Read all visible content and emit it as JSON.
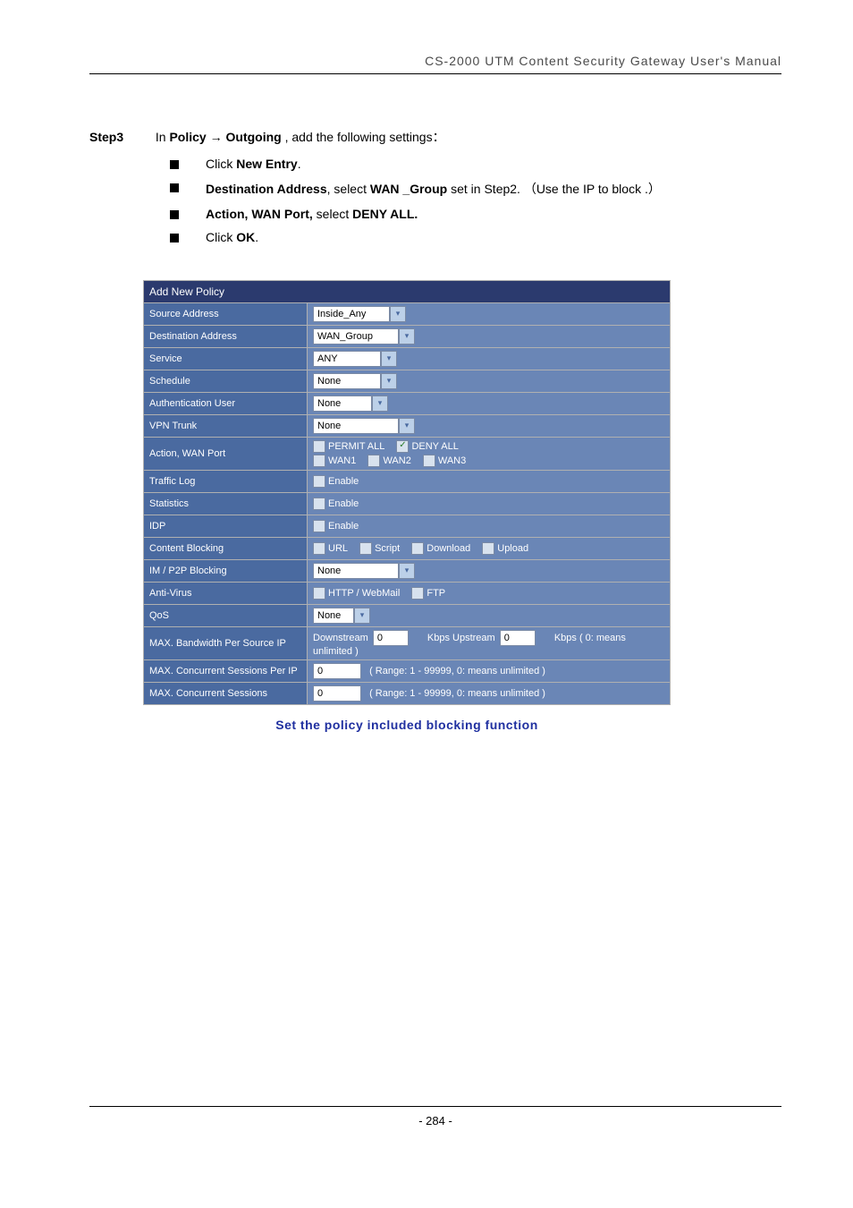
{
  "header": "CS-2000 UTM Content Security Gateway User's Manual",
  "step": {
    "label": "Step3",
    "pre": "In ",
    "b1": "Policy",
    "arrow": " → ",
    "b2": "Outgoing",
    "post": " , add the following settings："
  },
  "bullets": [
    {
      "parts": [
        {
          "t": "Click "
        },
        {
          "t": "New Entry",
          "b": true
        },
        {
          "t": "."
        }
      ]
    },
    {
      "parts": [
        {
          "t": "Destination Address",
          "b": true
        },
        {
          "t": ", select "
        },
        {
          "t": "WAN _Group",
          "b": true
        },
        {
          "t": " set in Step2. （Use the IP to block .）"
        }
      ]
    },
    {
      "parts": [
        {
          "t": "Action, WAN Port,",
          "b": true
        },
        {
          "t": " select "
        },
        {
          "t": "DENY ALL.",
          "b": true
        }
      ]
    },
    {
      "parts": [
        {
          "t": "Click "
        },
        {
          "t": "OK",
          "b": true
        },
        {
          "t": "."
        }
      ]
    }
  ],
  "policy": {
    "title": "Add New Policy",
    "rows": {
      "source_address": {
        "label": "Source Address",
        "value": "Inside_Any",
        "sel_w": 76
      },
      "destination_address": {
        "label": "Destination Address",
        "value": "WAN_Group",
        "sel_w": 86
      },
      "service": {
        "label": "Service",
        "value": "ANY",
        "sel_w": 66
      },
      "schedule": {
        "label": "Schedule",
        "value": "None",
        "sel_w": 66
      },
      "auth_user": {
        "label": "Authentication User",
        "value": "None",
        "sel_w": 56
      },
      "vpn_trunk": {
        "label": "VPN Trunk",
        "value": "None",
        "sel_w": 86
      },
      "action": {
        "label": "Action, WAN Port",
        "permit_all": "PERMIT ALL",
        "deny_all": "DENY ALL",
        "wan1": "WAN1",
        "wan2": "WAN2",
        "wan3": "WAN3",
        "deny_checked": "✓"
      },
      "traffic_log": {
        "label": "Traffic Log",
        "opt": "Enable"
      },
      "statistics": {
        "label": "Statistics",
        "opt": "Enable"
      },
      "idp": {
        "label": "IDP",
        "opt": "Enable"
      },
      "content_blocking": {
        "label": "Content Blocking",
        "url": "URL",
        "script": "Script",
        "download": "Download",
        "upload": "Upload"
      },
      "im_p2p": {
        "label": "IM / P2P Blocking",
        "value": "None",
        "sel_w": 86
      },
      "antivirus": {
        "label": "Anti-Virus",
        "http": "HTTP / WebMail",
        "ftp": "FTP"
      },
      "qos": {
        "label": "QoS",
        "value": "None",
        "sel_w": 36
      },
      "bw": {
        "label": "MAX. Bandwidth Per Source IP",
        "down_lbl": "Downstream",
        "down_val": "0",
        "up_lbl": "Kbps Upstream",
        "up_val": "0",
        "note": "Kbps ( 0: means unlimited )"
      },
      "sess_ip": {
        "label": "MAX. Concurrent Sessions Per IP",
        "val": "0",
        "note": "( Range: 1 - 99999, 0: means unlimited )"
      },
      "sess": {
        "label": "MAX. Concurrent Sessions",
        "val": "0",
        "note": "( Range: 1 - 99999, 0: means unlimited )"
      }
    }
  },
  "caption": "Set the policy included blocking function",
  "page_number": "- 284 -"
}
